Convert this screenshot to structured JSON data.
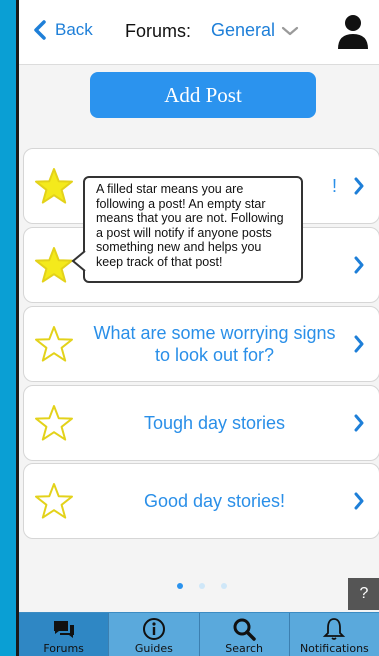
{
  "header": {
    "back_label": "Back",
    "forums_label": "Forums:",
    "forum_selected": "General"
  },
  "add_post_label": "Add Post",
  "tooltip": {
    "text": "A filled star means you are following a post! An empty star means that you are not. Following a post will notify if anyone posts something new and helps you keep track of that post!"
  },
  "posts": [
    {
      "title": "!",
      "starred": true
    },
    {
      "title": "",
      "starred": true
    },
    {
      "title": "What are some worrying signs to look out for?",
      "starred": false
    },
    {
      "title": "Tough day stories",
      "starred": false
    },
    {
      "title": "Good day stories!",
      "starred": false
    }
  ],
  "pagination": {
    "total": 3,
    "current": 1
  },
  "help_label": "?",
  "tabs": [
    {
      "label": "Forums",
      "icon": "forum-icon",
      "active": true
    },
    {
      "label": "Guides",
      "icon": "info-icon",
      "active": false
    },
    {
      "label": "Search",
      "icon": "search-icon",
      "active": false
    },
    {
      "label": "Notifications",
      "icon": "bell-icon",
      "active": false
    }
  ],
  "colors": {
    "accent": "#2b93ee",
    "star_fill": "#f4ea1c",
    "star_stroke": "#e3d21a",
    "tabbar": "#5aa9dc",
    "tab_active": "#2f87c4",
    "outer_bg": "#0a9fd4"
  }
}
